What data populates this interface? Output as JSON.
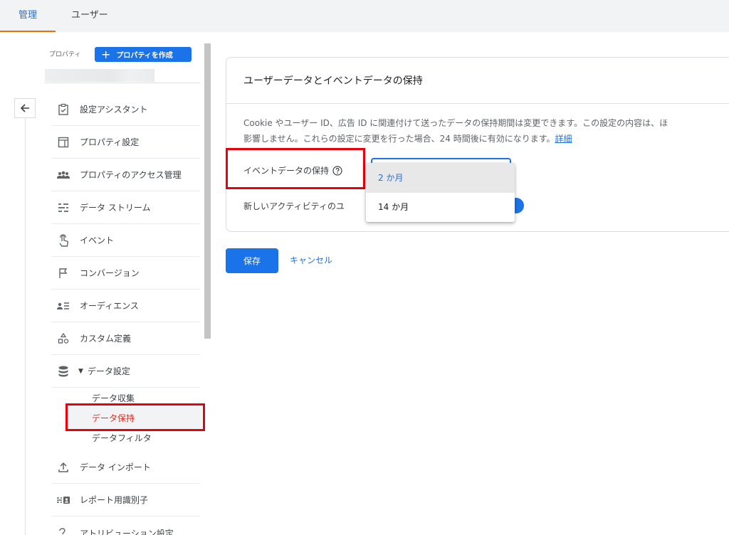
{
  "tabs": [
    {
      "label": "管理",
      "active": true
    },
    {
      "label": "ユーザー",
      "active": false
    }
  ],
  "sidebar": {
    "property_label": "プロパティ",
    "create_button": "プロパティを作成",
    "items": [
      {
        "label": "設定アシスタント",
        "icon": "clipboard-check-icon"
      },
      {
        "label": "プロパティ設定",
        "icon": "layout-icon"
      },
      {
        "label": "プロパティのアクセス管理",
        "icon": "people-icon"
      },
      {
        "label": "データ ストリーム",
        "icon": "streams-icon"
      },
      {
        "label": "イベント",
        "icon": "touch-icon"
      },
      {
        "label": "コンバージョン",
        "icon": "flag-icon"
      },
      {
        "label": "オーディエンス",
        "icon": "audience-icon"
      },
      {
        "label": "カスタム定義",
        "icon": "shapes-icon"
      },
      {
        "label": "データ設定",
        "icon": "database-icon",
        "expanded": true
      },
      {
        "label": "データ インポート",
        "icon": "upload-icon"
      },
      {
        "label": "レポート用識別子",
        "icon": "identifier-icon"
      },
      {
        "label": "アトリビューション設定",
        "icon": "attribution-icon"
      }
    ],
    "subitems": [
      {
        "label": "データ収集",
        "active": false
      },
      {
        "label": "データ保持",
        "active": true
      },
      {
        "label": "データフィルタ",
        "active": false
      }
    ]
  },
  "card": {
    "title": "ユーザーデータとイベントデータの保持",
    "description_line1": "Cookie やユーザー ID、広告 ID に関連付けて送ったデータの保持期間は変更できます。この設定の内容は、ほ",
    "description_line2": "影響しません。これらの設定に変更を行った場合、24 時間後に有効になります。",
    "learn_more": "詳細",
    "event_retention_label": "イベントデータの保持",
    "new_activity_label": "新しいアクティビティのユ"
  },
  "dropdown": {
    "options": [
      {
        "label": "2 か月",
        "selected": true
      },
      {
        "label": "14 か月",
        "selected": false
      }
    ]
  },
  "actions": {
    "save": "保存",
    "cancel": "キャンセル"
  },
  "colors": {
    "accent": "#1a73e8",
    "highlight_box": "#e8000b",
    "active_subitem": "#d93025",
    "tab_indicator": "#e37400"
  }
}
